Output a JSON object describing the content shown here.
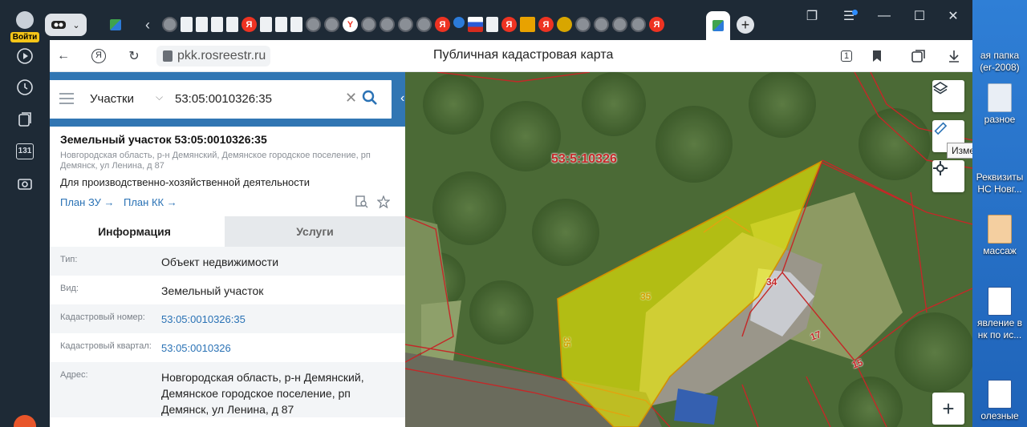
{
  "sidebar": {
    "login_label": "Войти",
    "badge": "131"
  },
  "tabs": {
    "favicons": [
      "av",
      "doc",
      "doc",
      "doc",
      "doc",
      "ya",
      "doc",
      "doc",
      "doc",
      "av",
      "av",
      "y",
      "av",
      "av",
      "av",
      "av",
      "ya",
      "dot",
      "flag",
      "doc",
      "ya",
      "img",
      "ya",
      "emb",
      "av",
      "av",
      "av",
      "av",
      "ya"
    ]
  },
  "addressbar": {
    "url": "pkk.rosreestr.ru",
    "page_title": "Публичная кадастровая карта",
    "tab_count": "1"
  },
  "search": {
    "category": "Участки",
    "query": "53:05:0010326:35"
  },
  "object": {
    "title": "Земельный участок 53:05:0010326:35",
    "address_short": "Новгородская область, р-н Демянский, Демянское городское поселение, рп Демянск, ул Ленина, д 87",
    "usage": "Для производственно-хозяйственной деятельности",
    "link_plan_zu": "План ЗУ →",
    "link_plan_kk": "План КК →"
  },
  "info_tabs": {
    "info": "Информация",
    "services": "Услуги"
  },
  "details": [
    {
      "label": "Тип:",
      "value": "Объект недвижимости",
      "link": false
    },
    {
      "label": "Вид:",
      "value": "Земельный участок",
      "link": false
    },
    {
      "label": "Кадастровый номер:",
      "value": "53:05:0010326:35",
      "link": true
    },
    {
      "label": "Кадастровый квартал:",
      "value": "53:05:0010326",
      "link": true
    },
    {
      "label": "Адрес:",
      "value": "Новгородская область, р-н Демянский, Демянское городское поселение, рп Демянск, ул Ленина, д 87",
      "link": false
    }
  ],
  "map": {
    "quarter_label": "53:5:10326",
    "parcel_35": "35",
    "parcel_35_side": "35",
    "parcel_34": "34",
    "parcel_17": "17",
    "parcel_15": "15",
    "tooltip": "Измерения"
  },
  "desktop": {
    "items": [
      "ая папка\n(er-2008)",
      "разное",
      "Реквизиты\nНС Новг...",
      "массаж",
      "явление в\nнк по ис...",
      "олезные"
    ]
  },
  "colors": {
    "accent": "#3176b3",
    "link": "#2a72b5",
    "parcel_fill": "#f2f000",
    "boundary": "#c42828"
  }
}
